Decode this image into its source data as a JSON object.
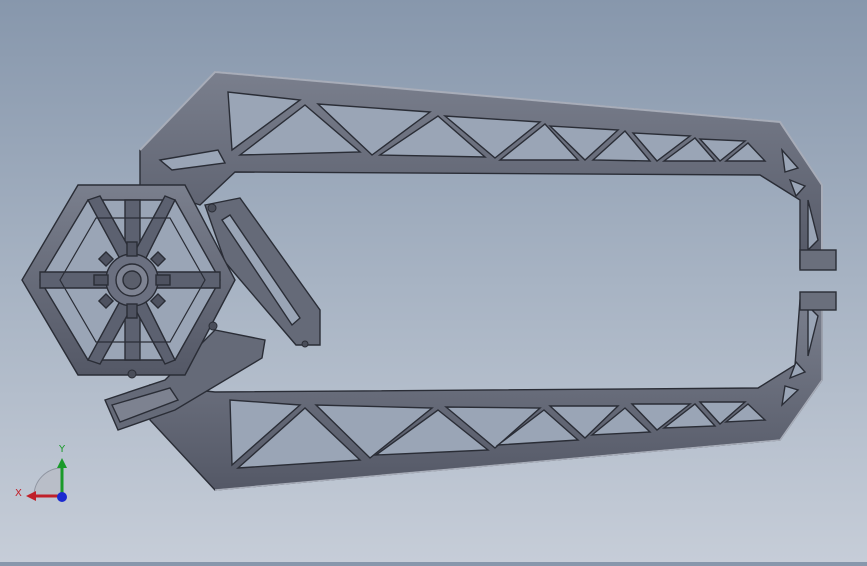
{
  "viewport": {
    "background_top": "#8797ac",
    "background_bottom": "#c6cdd8",
    "part_fill": "#5f6472",
    "part_edge": "#2a2d36",
    "part_highlight": "#8a8f9c"
  },
  "triad": {
    "x_label": "X",
    "y_label": "Y",
    "x_color": "#c0202a",
    "y_color": "#1a9a2a",
    "z_color": "#1a2ad0"
  }
}
